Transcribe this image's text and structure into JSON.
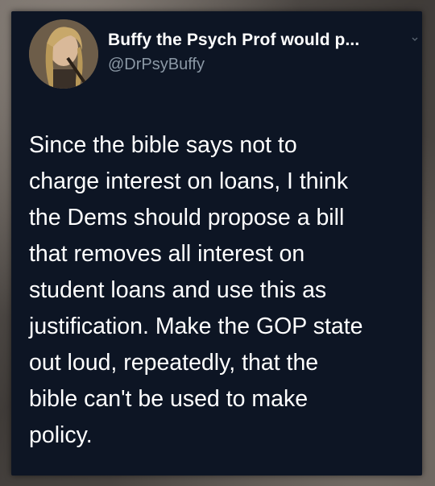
{
  "author": {
    "display_name": "Buffy the Psych Prof would p...",
    "handle": "@DrPsyBuffy",
    "avatar_icon": "profile-photo",
    "menu_icon": "chevron-down-icon"
  },
  "tweet": {
    "lines": [
      "Since the bible says not to",
      "charge interest on loans, I think",
      "the Dems should propose a bill",
      "that removes all interest on",
      "student loans and use this as",
      "justification. Make the GOP state",
      "out loud, repeatedly, that the",
      "bible can't be used to make",
      "policy."
    ]
  },
  "theme": {
    "card_bg": "#0d1524",
    "text_color": "#ffffff",
    "handle_color": "#8b98a5"
  }
}
